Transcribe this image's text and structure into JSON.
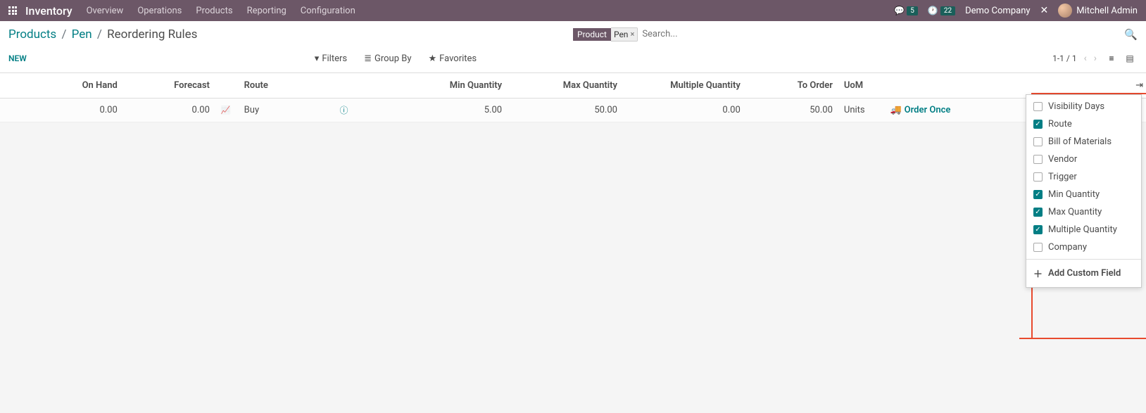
{
  "topbar": {
    "app": "Inventory",
    "menu": [
      "Overview",
      "Operations",
      "Products",
      "Reporting",
      "Configuration"
    ],
    "chat_badge": "5",
    "clock_badge": "22",
    "company": "Demo Company",
    "user": "Mitchell Admin"
  },
  "breadcrumb": {
    "a": "Products",
    "b": "Pen",
    "c": "Reordering Rules"
  },
  "search": {
    "chip_type": "Product",
    "chip_value": "Pen",
    "placeholder": "Search..."
  },
  "actions": {
    "new": "NEW",
    "filters": "Filters",
    "group_by": "Group By",
    "favorites": "Favorites"
  },
  "pager": {
    "range": "1-1 / 1"
  },
  "columns": {
    "on_hand": "On Hand",
    "forecast": "Forecast",
    "route": "Route",
    "min_qty": "Min Quantity",
    "max_qty": "Max Quantity",
    "multiple_qty": "Multiple Quantity",
    "to_order": "To Order",
    "uom": "UoM"
  },
  "row": {
    "on_hand": "0.00",
    "forecast": "0.00",
    "route": "Buy",
    "min_qty": "5.00",
    "max_qty": "50.00",
    "multiple_qty": "0.00",
    "to_order": "50.00",
    "uom": "Units",
    "order_btn": "Order Once"
  },
  "col_menu": {
    "items": [
      {
        "label": "Visibility Days",
        "checked": false
      },
      {
        "label": "Route",
        "checked": true
      },
      {
        "label": "Bill of Materials",
        "checked": false
      },
      {
        "label": "Vendor",
        "checked": false
      },
      {
        "label": "Trigger",
        "checked": false
      },
      {
        "label": "Min Quantity",
        "checked": true
      },
      {
        "label": "Max Quantity",
        "checked": true
      },
      {
        "label": "Multiple Quantity",
        "checked": true
      },
      {
        "label": "Company",
        "checked": false
      }
    ],
    "add": "Add Custom Field"
  }
}
